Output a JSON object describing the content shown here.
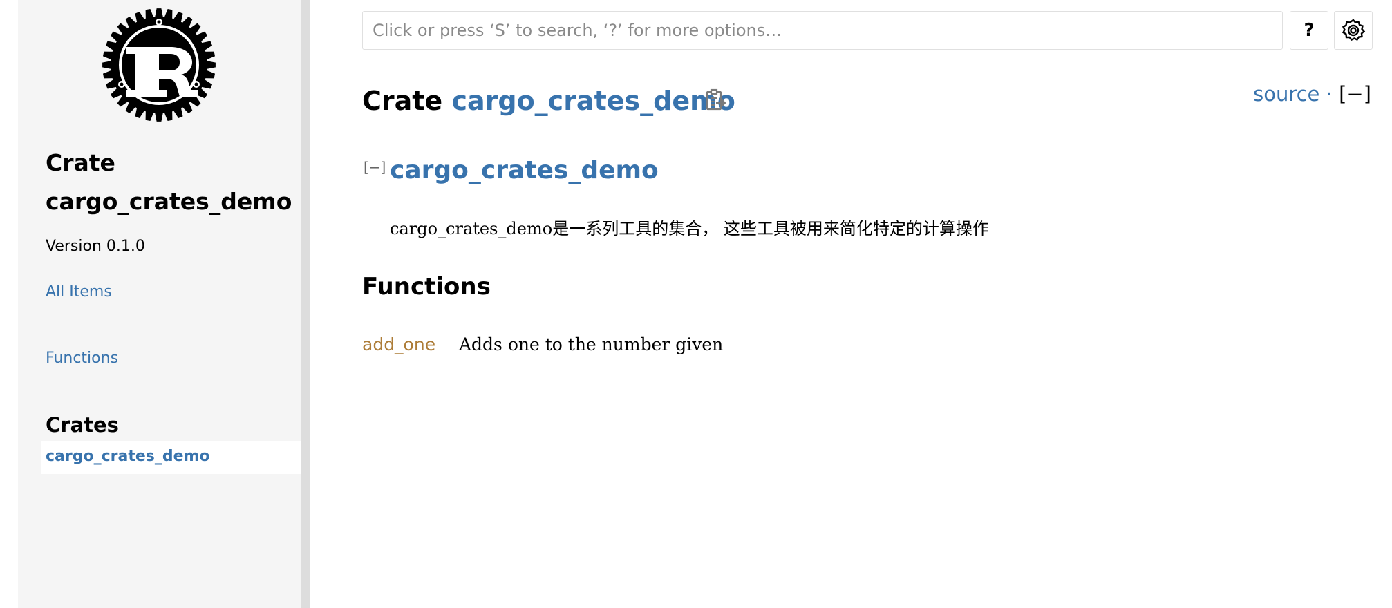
{
  "sidebar": {
    "crate_label": "Crate",
    "crate_name": "cargo_crates_demo",
    "version": "Version 0.1.0",
    "all_items": "All Items",
    "functions": "Functions",
    "crates_heading": "Crates",
    "current_crate": "cargo_crates_demo"
  },
  "search": {
    "placeholder": "Click or press ‘S’ to search, ‘?’ for more options…",
    "value": ""
  },
  "toolbar": {
    "help_label": "?"
  },
  "header": {
    "crate_label": "Crate",
    "crate_name": "cargo_crates_demo",
    "source_label": "source",
    "separator": "·",
    "collapse_label": "[−]"
  },
  "docblock": {
    "toggle_label": "[−]",
    "heading": "cargo_crates_demo",
    "text": "cargo_crates_demo是一系列工具的集合， 这些工具被用来简化特定的计算操作"
  },
  "functions_section": {
    "heading": "Functions",
    "items": [
      {
        "name": "add_one",
        "description": "Adds one to the number given"
      }
    ]
  },
  "colors": {
    "link": "#3873ad",
    "function": "#ad7c37",
    "sidebar_bg": "#f5f5f5"
  },
  "icons": {
    "logo": "rust-logo-icon",
    "settings": "gear-icon",
    "copy": "clipboard-icon"
  }
}
